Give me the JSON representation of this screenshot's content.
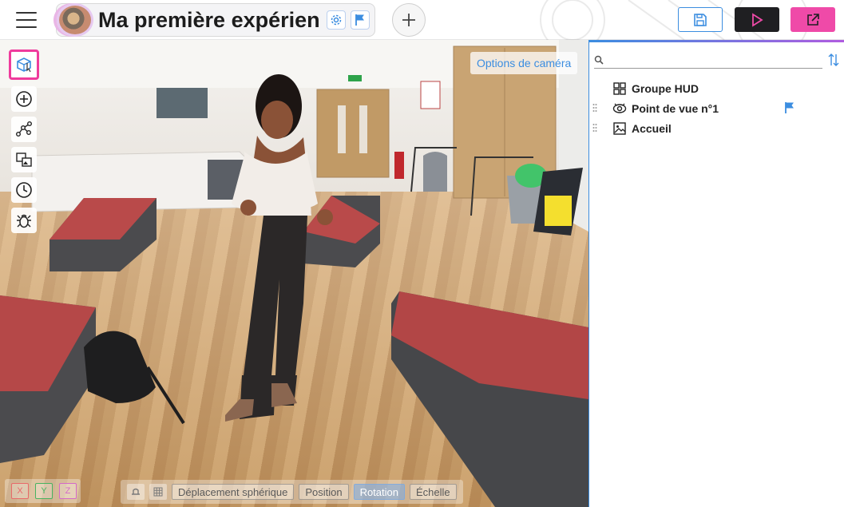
{
  "header": {
    "menu_icon": "hamburger-menu-icon",
    "project_title": "Ma première expérien",
    "settings_icon": "gear-icon",
    "flag_icon": "flag-icon",
    "add_icon": "plus-icon",
    "save_icon": "floppy-disk-icon",
    "play_icon": "play-icon",
    "share_icon": "external-link-icon",
    "colors": {
      "accent": "#3b8de0",
      "share": "#ef4aa8",
      "play_bg": "#1f1f22"
    }
  },
  "viewport": {
    "camera_options_label": "Options de caméra",
    "tools": [
      {
        "name": "3d-scene-tool",
        "icon": "cube-cursor-icon",
        "active": true
      },
      {
        "name": "add-tool",
        "icon": "plus-circle-icon"
      },
      {
        "name": "graph-tool",
        "icon": "nodes-graph-icon"
      },
      {
        "name": "media-tool",
        "icon": "image-swap-icon"
      },
      {
        "name": "timeline-tool",
        "icon": "clock-icon"
      },
      {
        "name": "debug-tool",
        "icon": "bug-icon"
      }
    ],
    "axes": {
      "x": "X",
      "y": "Y",
      "z": "Z"
    },
    "transform": {
      "spherical": "Déplacement sphérique",
      "position": "Position",
      "rotation": "Rotation",
      "scale": "Échelle"
    }
  },
  "panel": {
    "search_placeholder": "",
    "search_icon": "search-icon",
    "sort_icon": "sort-arrows-icon",
    "items": [
      {
        "label": "Groupe HUD",
        "icon": "grid-icon",
        "flag": false
      },
      {
        "label": "Point de vue n°1",
        "icon": "view-360-icon",
        "flag": true
      },
      {
        "label": "Accueil",
        "icon": "image-icon",
        "flag": false
      }
    ]
  }
}
